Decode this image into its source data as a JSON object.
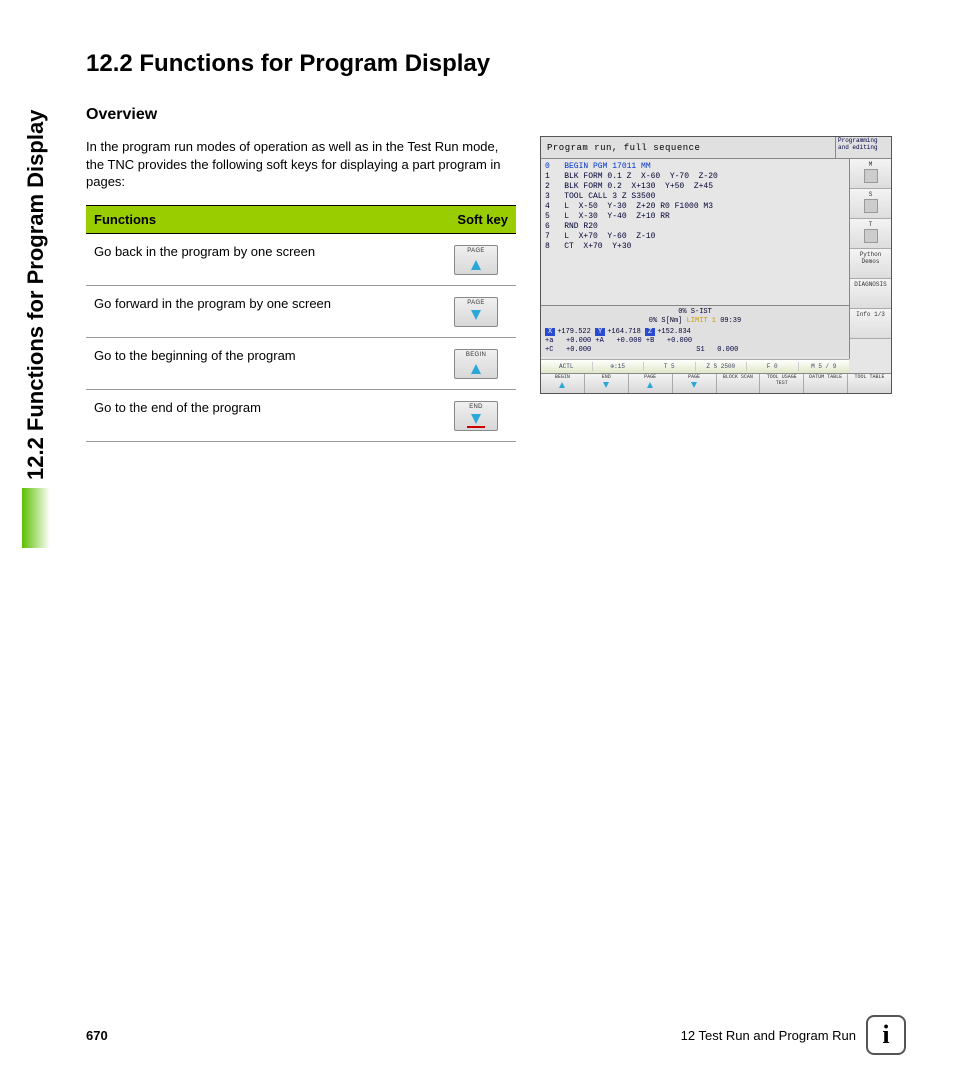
{
  "sideTab": "12.2 Functions for Program Display",
  "heading": "12.2  Functions for Program Display",
  "subheading": "Overview",
  "intro": "In the program run modes of operation as well as in the Test Run mode, the TNC provides the following soft keys for displaying a part program in pages:",
  "table": {
    "head_func": "Functions",
    "head_sk": "Soft key",
    "rows": [
      {
        "desc": "Go back in the program by one screen",
        "key": "PAGE",
        "dir": "up"
      },
      {
        "desc": "Go forward in the program by one screen",
        "key": "PAGE",
        "dir": "down"
      },
      {
        "desc": "Go to the beginning of the program",
        "key": "BEGIN",
        "dir": "up"
      },
      {
        "desc": "Go to the end of the program",
        "key": "END",
        "dir": "down"
      }
    ]
  },
  "cnc": {
    "title": "Program run, full sequence",
    "mode": "Programming and editing",
    "program": [
      "0   BEGIN PGM 17011 MM",
      "1   BLK FORM 0.1 Z  X-60  Y-70  Z-20",
      "2   BLK FORM 0.2  X+130  Y+50  Z+45",
      "3   TOOL CALL 3 Z S3500",
      "4   L  X-50  Y-30  Z+20 R0 F1000 M3",
      "5   L  X-30  Y-40  Z+10 RR",
      "6   RND R20",
      "7   L  X+70  Y-60  Z-10",
      "8   CT  X+70  Y+30"
    ],
    "status_line1": "0% S-IST",
    "status_line2a": "0% S[Nm]",
    "status_limit": "LIMIT 1",
    "status_time": "09:39",
    "coords": {
      "X": "+179.522",
      "Y": "+164.718",
      "Z": "+152.834",
      "a": "+0.000",
      "A": "+0.000",
      "B": "+0.000",
      "C": "+0.000",
      "S1": "0.000"
    },
    "strip": {
      "actl": "ACTL",
      "d": "⊕:15",
      "t": "T 5",
      "z": "Z S 2500",
      "f": "F 0",
      "m": "M 5 / 9"
    },
    "side": [
      "M",
      "S",
      "T",
      "Python Demos",
      "DIAGNOSIS",
      "Info 1/3"
    ],
    "bottom": [
      "BEGIN",
      "END",
      "PAGE",
      "PAGE",
      "BLOCK SCAN",
      "TOOL USAGE TEST",
      "DATUM TABLE",
      "TOOL TABLE"
    ]
  },
  "footer": {
    "page": "670",
    "chapter": "12 Test Run and Program Run",
    "info": "i"
  }
}
